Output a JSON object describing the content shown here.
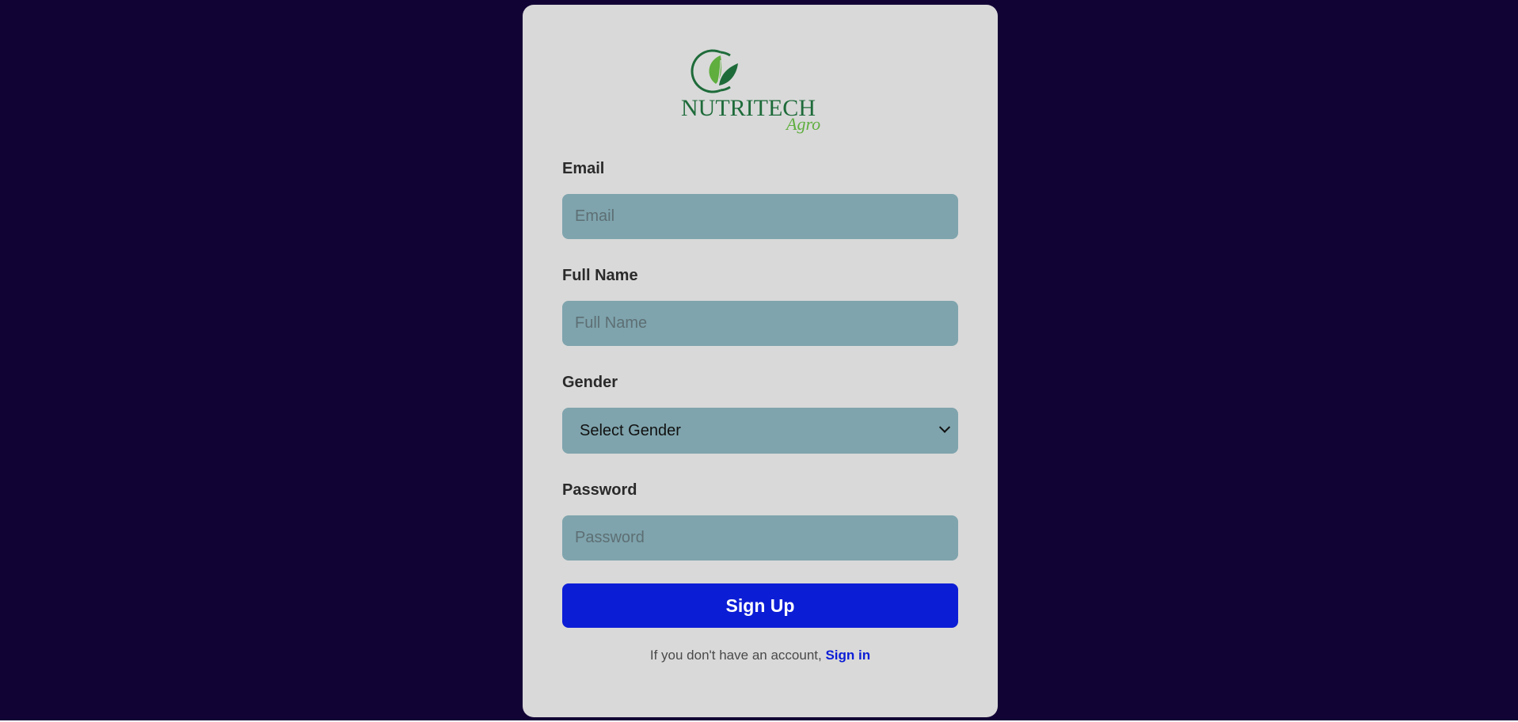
{
  "brand": {
    "logo_text_main": "NUTRITECH",
    "logo_text_sub": "Agro",
    "logo_icon": "leaf-icon",
    "colors": {
      "page_background": "#120335",
      "card_background": "#d9d9d9",
      "input_background": "#7fa4ad",
      "primary_button": "#0c1dd6",
      "logo_green": "#1e6b3a",
      "logo_light_green": "#5fae3e"
    }
  },
  "form": {
    "email": {
      "label": "Email",
      "placeholder": "Email",
      "value": ""
    },
    "full_name": {
      "label": "Full Name",
      "placeholder": "Full Name",
      "value": ""
    },
    "gender": {
      "label": "Gender",
      "selected": "Select Gender"
    },
    "password": {
      "label": "Password",
      "placeholder": "Password",
      "value": ""
    },
    "submit_label": "Sign Up"
  },
  "footer": {
    "prompt": "If you don't have an account, ",
    "link_label": "Sign in"
  }
}
